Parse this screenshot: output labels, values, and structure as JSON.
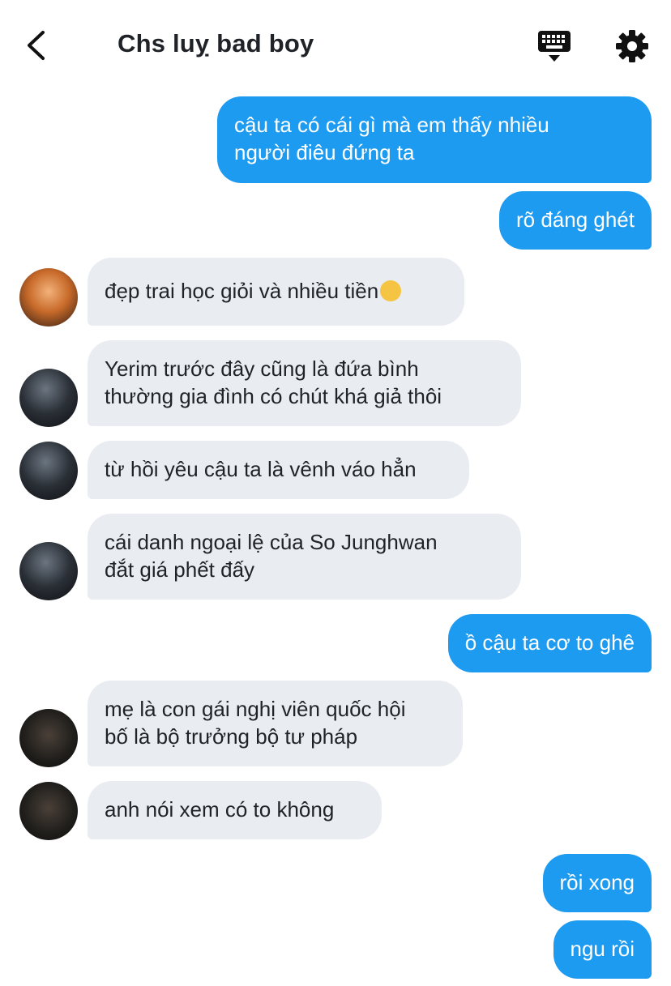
{
  "header": {
    "title": "Chs luỵ bad boy",
    "back_icon": "chevron-left-icon",
    "keyboard_icon": "keyboard-icon",
    "settings_icon": "gear-icon"
  },
  "colors": {
    "outgoing_bubble": "#1d9bf0",
    "incoming_bubble": "#e9edf1",
    "text_dark": "#1f2328"
  },
  "messages": [
    {
      "direction": "out",
      "lines": [
        "cậu ta có cái gì mà em thấy nhiều",
        "người điêu đứng ta"
      ]
    },
    {
      "direction": "out",
      "lines": [
        "rõ đáng ghét"
      ]
    },
    {
      "direction": "in",
      "avatar": "avatar-a",
      "lines": [
        "đẹp trai học giỏi và nhiều tiền"
      ],
      "emoji": "yawning-face-emoji"
    },
    {
      "direction": "in",
      "avatar": "avatar-b",
      "lines": [
        "Yerim trước đây cũng là đứa bình",
        "thường gia đình có chút khá giả thôi"
      ]
    },
    {
      "direction": "in",
      "avatar": "avatar-b",
      "lines": [
        "từ hồi yêu cậu ta là vênh váo hẳn"
      ]
    },
    {
      "direction": "in",
      "avatar": "avatar-b",
      "lines": [
        "cái danh ngoại lệ của So Junghwan",
        "đắt giá phết đấy"
      ]
    },
    {
      "direction": "out",
      "lines": [
        "ồ cậu ta cơ to ghê"
      ]
    },
    {
      "direction": "in",
      "avatar": "avatar-c",
      "lines": [
        "mẹ là con gái nghị viên quốc hội",
        "bố là bộ trưởng bộ tư pháp"
      ]
    },
    {
      "direction": "in",
      "avatar": "avatar-c",
      "lines": [
        "anh nói xem có to không"
      ]
    },
    {
      "direction": "out",
      "lines": [
        "rồi xong"
      ]
    },
    {
      "direction": "out",
      "lines": [
        "ngu rồi"
      ]
    }
  ]
}
